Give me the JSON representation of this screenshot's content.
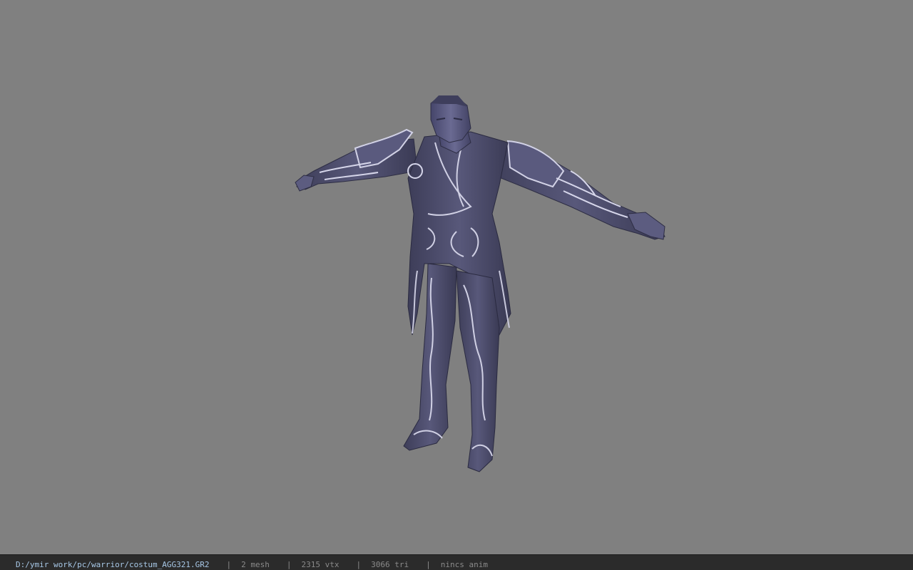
{
  "viewer": {
    "background_color": "#808080",
    "model_color": "#4b4b68",
    "trim_color": "#c9c9de"
  },
  "statusbar": {
    "file_path": "D:/ymir work/pc/warrior/costum_AGG321.GR2",
    "separator": "|",
    "mesh": "2 mesh",
    "vertices": "2315 vtx",
    "triangles": "3066 tri",
    "animation": "nincs anim"
  }
}
